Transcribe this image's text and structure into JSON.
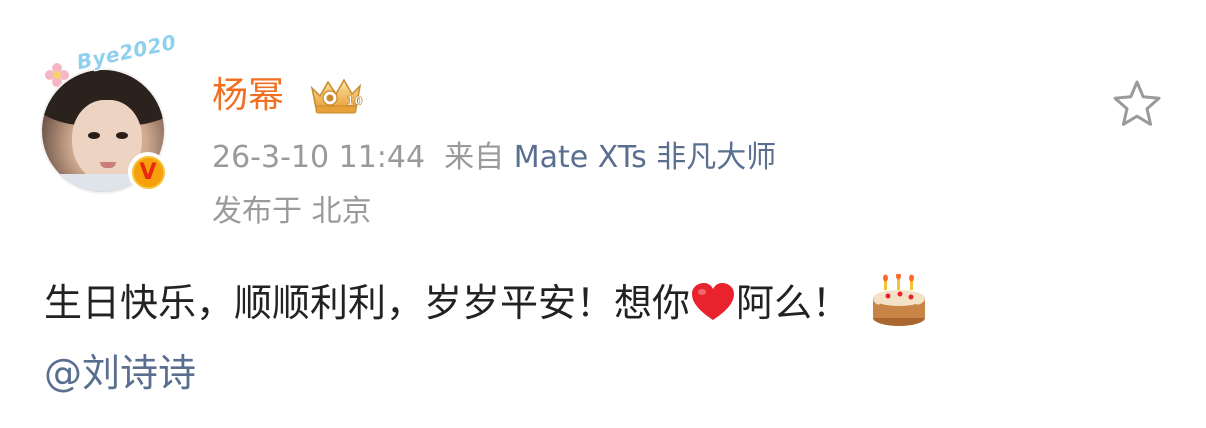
{
  "post": {
    "author": {
      "name": "杨幂",
      "avatar_sticker": "Bye2020",
      "verified_badge": "V",
      "vip_badge": {
        "level": "10",
        "icon": "crown-vip-badge"
      }
    },
    "meta": {
      "timestamp": "26-3-10 11:44",
      "source_prefix": "来自",
      "source_device": "Mate XTs 非凡大师",
      "location": "发布于 北京"
    },
    "content": {
      "text_part1": "生日快乐，顺顺利利，岁岁平安！想你",
      "emoji_heart": "heart-icon",
      "text_part2": "阿么！",
      "emoji_cake": "birthday-cake-icon",
      "mention": "@刘诗诗"
    },
    "actions": {
      "favorite_icon": "star-outline-icon"
    }
  },
  "colors": {
    "username": "#f26f21",
    "meta_text": "#9a9a9a",
    "link_text": "#5a6f90",
    "body_text": "#222222",
    "heart": "#e8232e"
  }
}
